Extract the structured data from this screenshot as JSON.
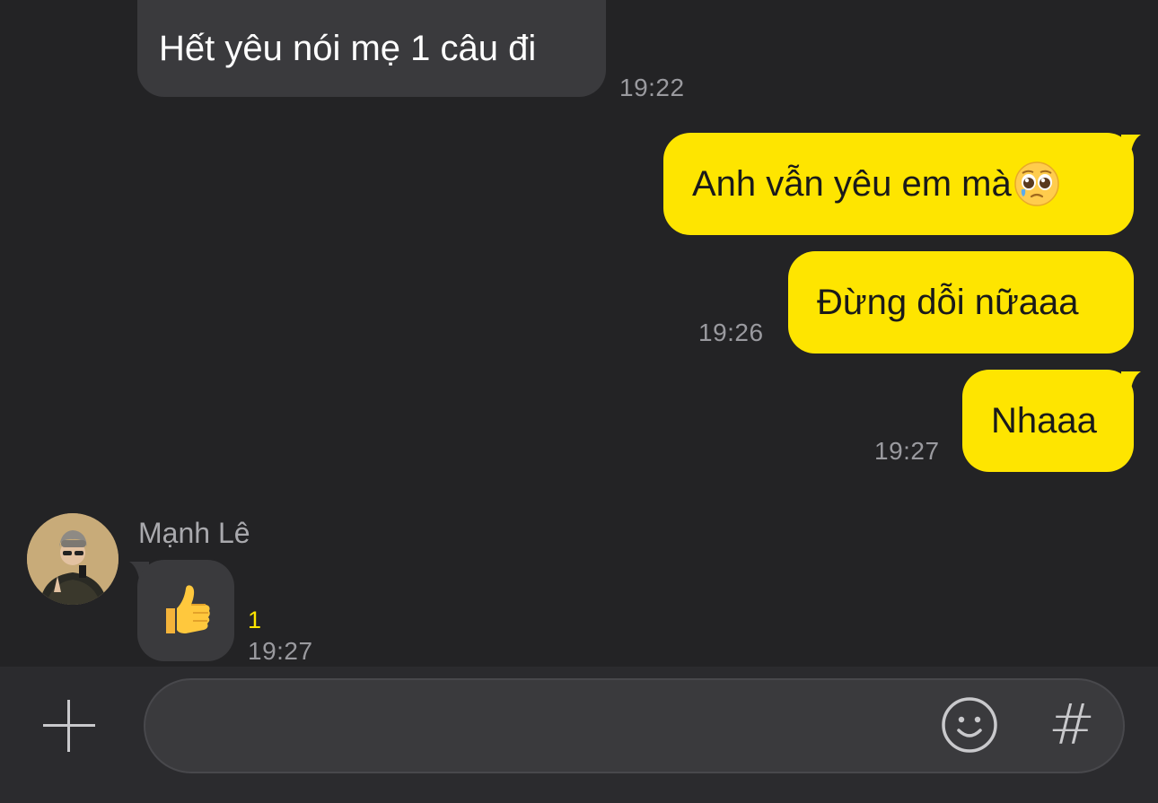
{
  "messages": {
    "m1": {
      "text": "Hết yêu nói mẹ 1 câu đi",
      "time": "19:22"
    },
    "m2": {
      "text": "Anh vẫn yêu em mà"
    },
    "m3": {
      "text": "Đừng dỗi nữaaa",
      "time": "19:26"
    },
    "m4": {
      "text": "Nhaaa",
      "time": "19:27"
    },
    "m5": {
      "sender": "Mạnh Lê",
      "emoji": "👍",
      "unread": "1",
      "time": "19:27"
    }
  },
  "input": {
    "placeholder": ""
  },
  "colors": {
    "background": "#232325",
    "incoming_bubble": "#3a3a3d",
    "outgoing_bubble": "#fee500",
    "unread_count": "#fee500",
    "time_text": "#9a9a9f"
  },
  "icons": [
    "plus-icon",
    "emoji-icon",
    "hashtag-icon",
    "pleading-face-emoji",
    "thumbs-up-emoji"
  ]
}
